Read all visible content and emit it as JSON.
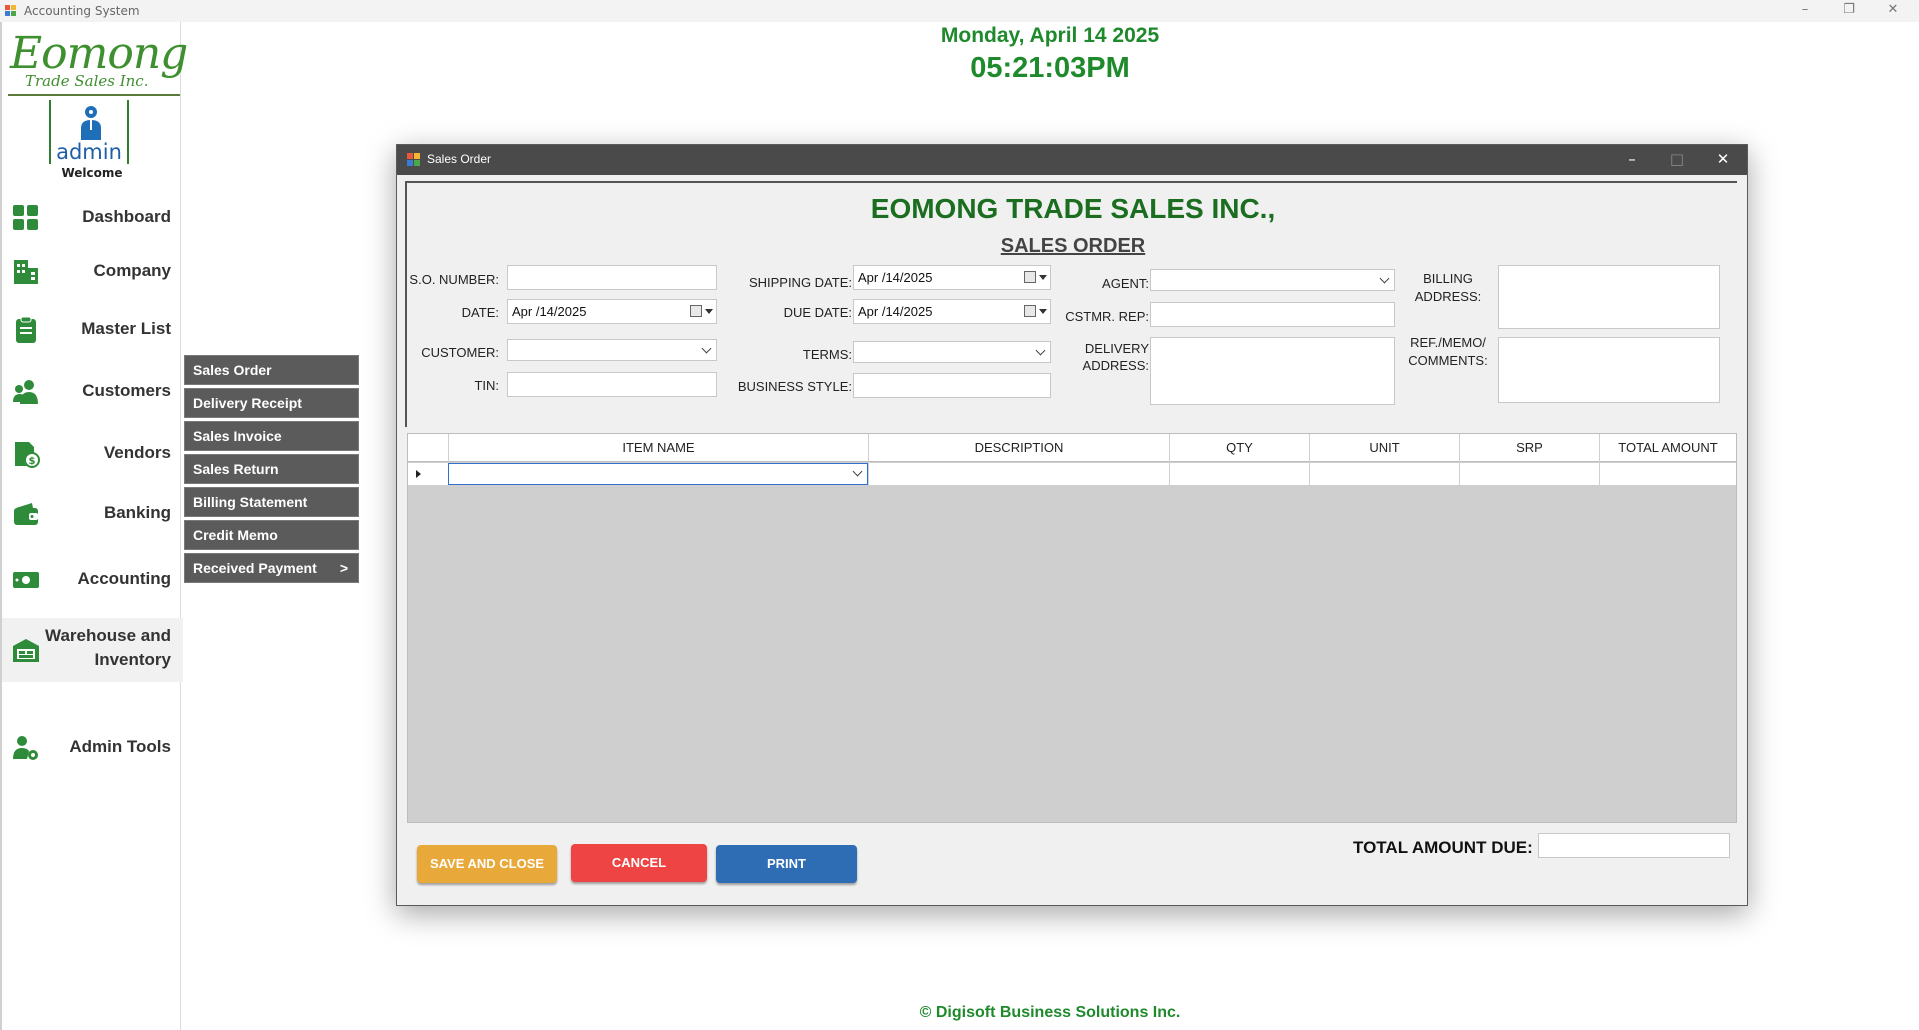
{
  "window": {
    "title": "Accounting System",
    "controls": {
      "minimize": "–",
      "restore": "❐",
      "close": "✕"
    }
  },
  "brand": {
    "logo_main": "Eomong",
    "logo_sub": "Trade Sales Inc.",
    "green": "#1e8a2c"
  },
  "user": {
    "name": "admin",
    "welcome": "Welcome"
  },
  "sidebar": {
    "items": [
      {
        "label": "Dashboard",
        "icon": "grid-icon"
      },
      {
        "label": "Company",
        "icon": "building-icon"
      },
      {
        "label": "Master List",
        "icon": "clipboard-icon"
      },
      {
        "label": "Customers",
        "icon": "people-icon"
      },
      {
        "label": "Vendors",
        "icon": "invoice-dollar-icon"
      },
      {
        "label": "Banking",
        "icon": "wallet-icon"
      },
      {
        "label": "Accounting",
        "icon": "money-icon"
      },
      {
        "label": "Warehouse and Inventory",
        "icon": "warehouse-icon"
      },
      {
        "label": "Admin Tools",
        "icon": "user-gear-icon"
      }
    ]
  },
  "submenu": {
    "items": [
      "Sales Order",
      "Delivery Receipt",
      "Sales Invoice",
      "Sales Return",
      "Billing Statement",
      "Credit Memo",
      "Received Payment"
    ],
    "last_arrow": ">"
  },
  "header": {
    "date": "Monday, April 14 2025",
    "time": "05:21:03PM"
  },
  "footer": {
    "text": "© Digisoft Business Solutions Inc."
  },
  "dialog": {
    "title": "Sales Order",
    "company_name": "EOMONG TRADE SALES INC.,",
    "form_title": "SALES ORDER",
    "labels": {
      "so_number": "S.O. NUMBER:",
      "date": "DATE:",
      "customer": "CUSTOMER:",
      "tin": "TIN:",
      "shipping_date": "SHIPPING DATE:",
      "due_date": "DUE DATE:",
      "terms": "TERMS:",
      "business_style": "BUSINESS STYLE:",
      "agent": "AGENT:",
      "cstmr_rep": "CSTMR. REP:",
      "delivery_address_1": "DELIVERY",
      "delivery_address_2": "ADDRESS:",
      "billing_address_1": "BILLING",
      "billing_address_2": "ADDRESS:",
      "ref_memo_1": "REF./MEMO/",
      "ref_memo_2": "COMMENTS:",
      "total_amount_due": "TOTAL AMOUNT DUE:"
    },
    "values": {
      "so_number": "",
      "date": "Apr /14/2025",
      "customer": "",
      "tin": "",
      "shipping_date": "Apr /14/2025",
      "due_date": "Apr /14/2025",
      "terms": "",
      "business_style": "",
      "agent": "",
      "cstmr_rep": "",
      "delivery_address": "",
      "billing_address": "",
      "ref_memo": "",
      "total_amount_due": ""
    },
    "grid": {
      "columns": [
        "ITEM NAME",
        "DESCRIPTION",
        "QTY",
        "UNIT",
        "SRP",
        "TOTAL AMOUNT"
      ]
    },
    "buttons": {
      "save_and_close": "SAVE AND CLOSE",
      "cancel": "CANCEL",
      "print": "PRINT"
    },
    "colors": {
      "save": "#e8a93a",
      "cancel": "#ee4444",
      "print": "#2e6db4"
    }
  }
}
